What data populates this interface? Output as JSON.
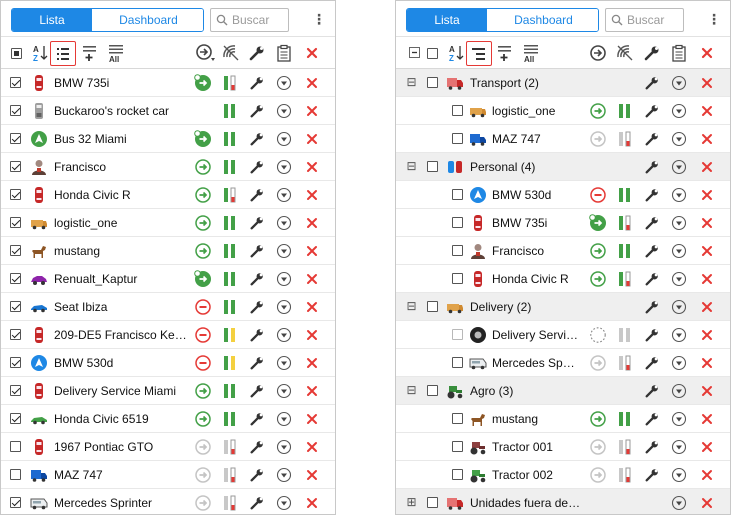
{
  "tabs": {
    "list": "Lista",
    "dashboard": "Dashboard"
  },
  "search": {
    "placeholder": "Buscar"
  },
  "menu_glyph": "⋮",
  "expander": {
    "collapse": "⊟",
    "expand": "⊞"
  },
  "left_units": [
    {
      "name": "BMW 735i",
      "checked": true,
      "icon": "car-red-icon",
      "cmd": "green-flag",
      "sig": "gr"
    },
    {
      "name": "Buckaroo's rocket car",
      "checked": true,
      "icon": "rocket-car-icon",
      "cmd": "none",
      "sig": "gg"
    },
    {
      "name": "Bus 32 Miami",
      "checked": true,
      "icon": "green-arrow-icon",
      "cmd": "green-flag",
      "sig": "gg"
    },
    {
      "name": "Francisco",
      "checked": true,
      "icon": "person-icon",
      "cmd": "green",
      "sig": "gg"
    },
    {
      "name": "Honda Civic R",
      "checked": true,
      "icon": "car-red-icon",
      "cmd": "green",
      "sig": "gr"
    },
    {
      "name": "logistic_one",
      "checked": true,
      "icon": "van-icon",
      "cmd": "green",
      "sig": "gg"
    },
    {
      "name": "mustang",
      "checked": true,
      "icon": "horse-icon",
      "cmd": "green",
      "sig": "gg"
    },
    {
      "name": "Renualt_Kaptur",
      "checked": true,
      "icon": "car-purple-icon",
      "cmd": "green-flag",
      "sig": "gg"
    },
    {
      "name": "Seat Ibiza",
      "checked": true,
      "icon": "car-blue-icon",
      "cmd": "red",
      "sig": "gg"
    },
    {
      "name": "209-DE5 Francisco Ke…",
      "checked": true,
      "icon": "car-red-icon",
      "cmd": "red",
      "sig": "gy"
    },
    {
      "name": "BMW 530d",
      "checked": true,
      "icon": "blue-arrow-icon",
      "cmd": "red",
      "sig": "gy"
    },
    {
      "name": "Delivery Service Miami",
      "checked": true,
      "icon": "car-red-icon",
      "cmd": "green",
      "sig": "gg"
    },
    {
      "name": "Honda Civic 6519",
      "checked": true,
      "icon": "car-green-icon",
      "cmd": "green",
      "sig": "gg"
    },
    {
      "name": "1967 Pontiac GTO",
      "checked": false,
      "icon": "car-red-icon",
      "cmd": "gray",
      "sig": "xr"
    },
    {
      "name": "MAZ 747",
      "checked": false,
      "icon": "truck-blue-icon",
      "cmd": "gray",
      "sig": "xr"
    },
    {
      "name": "Mercedes Sprinter",
      "checked": true,
      "icon": "minibus-icon",
      "cmd": "gray",
      "sig": "xr"
    }
  ],
  "right_rows": [
    {
      "type": "group",
      "name": "Transport (2)",
      "icon": "truck-red-icon",
      "exp": "collapse"
    },
    {
      "type": "unit",
      "name": "logistic_one",
      "icon": "van-icon",
      "cmd": "green",
      "sig": "gg"
    },
    {
      "type": "unit",
      "name": "MAZ 747",
      "icon": "truck-blue-icon",
      "cmd": "gray",
      "sig": "xr"
    },
    {
      "type": "group",
      "name": "Personal (4)",
      "icon": "cars-group-icon",
      "exp": "collapse"
    },
    {
      "type": "unit",
      "name": "BMW 530d",
      "icon": "blue-arrow-icon",
      "cmd": "red",
      "sig": "gg"
    },
    {
      "type": "unit",
      "name": "BMW 735i",
      "icon": "car-red-icon",
      "cmd": "green-flag",
      "sig": "gr"
    },
    {
      "type": "unit",
      "name": "Francisco",
      "icon": "person-icon",
      "cmd": "green",
      "sig": "gg"
    },
    {
      "type": "unit",
      "name": "Honda Civic R",
      "icon": "car-red-icon",
      "cmd": "green",
      "sig": "gr"
    },
    {
      "type": "group",
      "name": "Delivery (2)",
      "icon": "van-icon",
      "exp": "collapse"
    },
    {
      "type": "unit",
      "name": "Delivery Servi…",
      "icon": "wheel-icon",
      "cmd": "dashed",
      "sig": "xx",
      "dim": true
    },
    {
      "type": "unit",
      "name": "Mercedes Spr…",
      "icon": "minibus-icon",
      "cmd": "gray",
      "sig": "xr"
    },
    {
      "type": "group",
      "name": "Agro (3)",
      "icon": "tractor-group-icon",
      "exp": "collapse"
    },
    {
      "type": "unit",
      "name": "mustang",
      "icon": "horse-icon",
      "cmd": "green",
      "sig": "gg"
    },
    {
      "type": "unit",
      "name": "Tractor 001",
      "icon": "tractor-red-icon",
      "cmd": "gray",
      "sig": "xr"
    },
    {
      "type": "unit",
      "name": "Tractor 002",
      "icon": "tractor-green-icon",
      "cmd": "gray",
      "sig": "xr"
    },
    {
      "type": "group",
      "name": "Unidades fuera de…",
      "icon": "truck-red-icon",
      "exp": "expand",
      "partial": true
    }
  ],
  "colors": {
    "accent": "#1e88e5",
    "green": "#43a047",
    "red": "#e53935",
    "yellow": "#f4d03f",
    "gray": "#bdbdbd"
  }
}
